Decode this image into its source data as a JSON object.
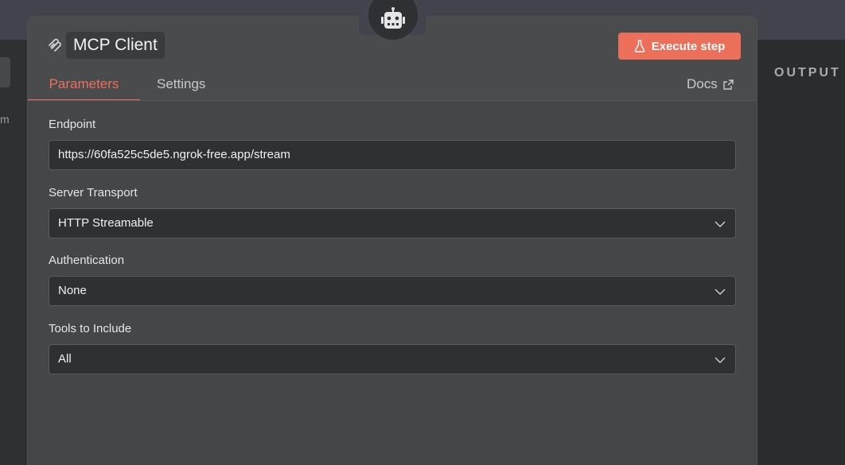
{
  "background": {
    "left_text": "m",
    "output_label": "OUTPUT"
  },
  "node": {
    "icon": "robot-icon",
    "title_icon": "mcp-icon",
    "title": "MCP Client"
  },
  "execute_button": {
    "label": "Execute step",
    "icon": "flask-icon"
  },
  "tabs": [
    {
      "label": "Parameters",
      "active": true
    },
    {
      "label": "Settings",
      "active": false
    }
  ],
  "docs": {
    "label": "Docs",
    "icon": "external-link-icon"
  },
  "fields": {
    "endpoint": {
      "label": "Endpoint",
      "value": "https://60fa525c5de5.ngrok-free.app/stream"
    },
    "server_transport": {
      "label": "Server Transport",
      "value": "HTTP Streamable"
    },
    "authentication": {
      "label": "Authentication",
      "value": "None"
    },
    "tools_to_include": {
      "label": "Tools to Include",
      "value": "All"
    }
  },
  "colors": {
    "accent": "#ec6f5a",
    "panel": "#454648",
    "input_bg": "#2f3031"
  }
}
